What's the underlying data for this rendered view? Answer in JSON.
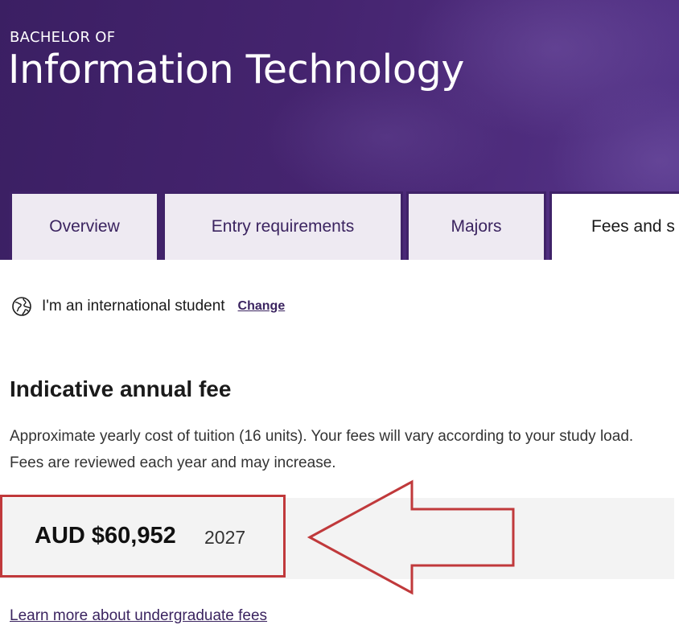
{
  "hero": {
    "eyebrow": "BACHELOR OF",
    "title": "Information Technology"
  },
  "tabs": [
    {
      "label": "Overview",
      "active": false
    },
    {
      "label": "Entry requirements",
      "active": false
    },
    {
      "label": "Majors",
      "active": false
    },
    {
      "label": "Fees and s",
      "active": true
    }
  ],
  "student": {
    "icon": "globe-icon",
    "text": "I'm an international student",
    "change_label": "Change"
  },
  "fees": {
    "heading": "Indicative annual fee",
    "description": "Approximate yearly cost of tuition (16 units). Your fees will vary according to your study load. Fees are reviewed each year and may increase.",
    "amount": "AUD $60,952",
    "year": "2027",
    "learn_more": "Learn more about undergraduate fees"
  },
  "annotation": {
    "highlight_color": "#c0393b",
    "arrow": "left-arrow-outline"
  },
  "colors": {
    "brand_purple": "#3f2268",
    "tab_bg": "#eeeaf2",
    "fee_box_bg": "#f3f3f3"
  }
}
